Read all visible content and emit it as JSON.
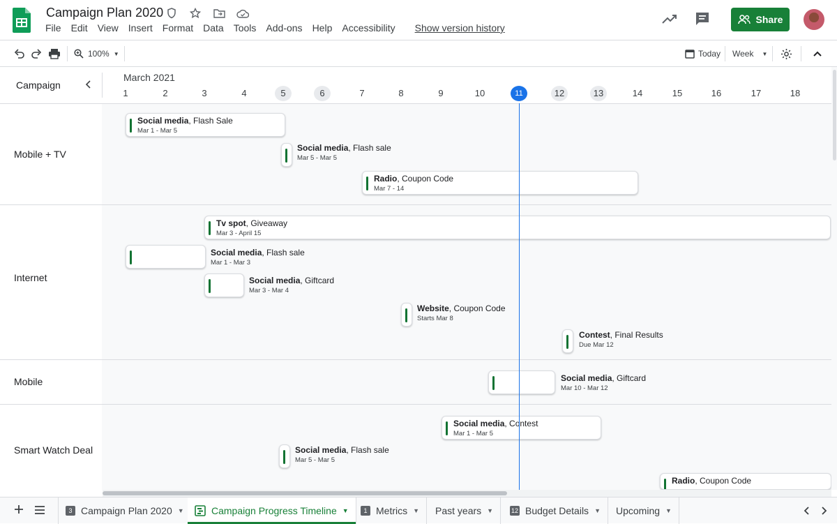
{
  "app": {
    "title": "Campaign Plan 2020",
    "menu": [
      "File",
      "Edit",
      "View",
      "Insert",
      "Format",
      "Data",
      "Tools",
      "Add-ons",
      "Help",
      "Accessibility"
    ],
    "version_history": "Show version history",
    "share_label": "Share",
    "brand_color": "#188038"
  },
  "toolbar": {
    "zoom": "100%",
    "today_label": "Today",
    "view_mode": "Week"
  },
  "timeline": {
    "column_header": "Campaign",
    "month": "March 2021",
    "days": [
      "1",
      "2",
      "3",
      "4",
      "5",
      "6",
      "7",
      "8",
      "9",
      "10",
      "11",
      "12",
      "13",
      "14",
      "15",
      "16",
      "17",
      "18"
    ],
    "weekend_days": [
      "5",
      "6",
      "12",
      "13"
    ],
    "today": "11",
    "groups": [
      {
        "name": "Mobile + TV"
      },
      {
        "name": "Internet"
      },
      {
        "name": "Mobile"
      },
      {
        "name": "Smart Watch Deal"
      }
    ],
    "cards": [
      {
        "type": "Social media",
        "name": "Flash Sale",
        "dates": "Mar 1 - Mar 5"
      },
      {
        "type": "Social media",
        "name": "Flash sale",
        "dates": "Mar 5 - Mar 5"
      },
      {
        "type": "Radio",
        "name": "Coupon Code",
        "dates": "Mar 7 - 14"
      },
      {
        "type": "Tv spot",
        "name": "Giveaway",
        "dates": "Mar 3 - April 15"
      },
      {
        "type": "Social media",
        "name": "Flash sale",
        "dates": "Mar 1 - Mar 3"
      },
      {
        "type": "Social media",
        "name": "Giftcard",
        "dates": "Mar 3 - Mar 4"
      },
      {
        "type": "Website",
        "name": "Coupon Code",
        "dates": "Starts Mar 8"
      },
      {
        "type": "Contest",
        "name": "Final Results",
        "dates": "Due Mar 12"
      },
      {
        "type": "Social media",
        "name": "Giftcard",
        "dates": "Mar 10 - Mar 12"
      },
      {
        "type": "Social media",
        "name": "Contest",
        "dates": "Mar 1 - Mar 5"
      },
      {
        "type": "Social media",
        "name": "Flash sale",
        "dates": "Mar 5 - Mar 5"
      },
      {
        "type": "Radio",
        "name": "Coupon Code",
        "dates": ""
      }
    ]
  },
  "sheets": {
    "tabs": [
      {
        "label": "Campaign Plan 2020",
        "icon": "3"
      },
      {
        "label": "Campaign Progress Timeline",
        "icon": "timeline"
      },
      {
        "label": "Metrics",
        "icon": "1"
      },
      {
        "label": "Past years",
        "icon": ""
      },
      {
        "label": "Budget Details",
        "icon": "12"
      },
      {
        "label": "Upcoming",
        "icon": ""
      }
    ]
  }
}
